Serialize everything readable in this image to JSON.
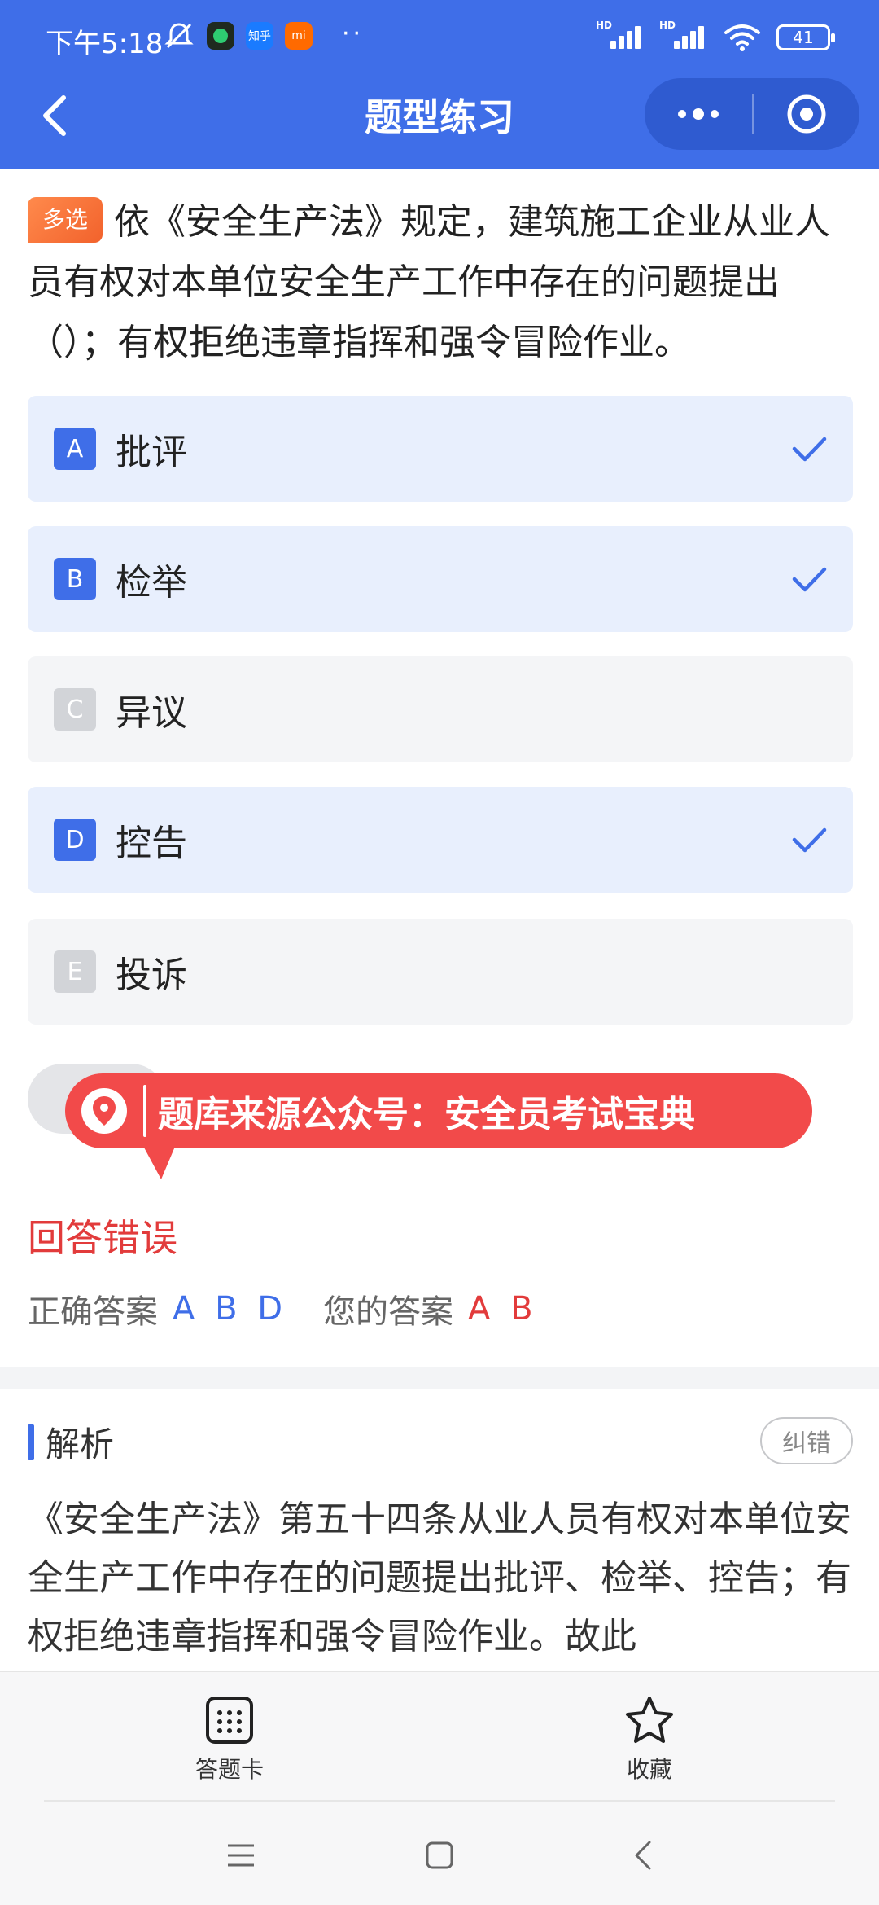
{
  "status_bar": {
    "time": "下午5:18",
    "app_icon_zhihu": "知乎",
    "app_icon_mi": "mi",
    "more_indicator": "··",
    "battery": "41",
    "signal_1": "HD",
    "signal_2": "HD"
  },
  "header": {
    "title": "题型练习"
  },
  "question": {
    "tag": "多选",
    "text": "依《安全生产法》规定，建筑施工企业从业人员有权对本单位安全生产工作中存在的问题提出（）；有权拒绝违章指挥和强令冒险作业。"
  },
  "options": [
    {
      "letter": "A",
      "text": "批评",
      "selected": true
    },
    {
      "letter": "B",
      "text": "检举",
      "selected": true
    },
    {
      "letter": "C",
      "text": "异议",
      "selected": false
    },
    {
      "letter": "D",
      "text": "控告",
      "selected": true
    },
    {
      "letter": "E",
      "text": "投诉",
      "selected": false
    }
  ],
  "watermark": {
    "text": "题库来源公众号：安全员考试宝典"
  },
  "result": {
    "title": "回答错误",
    "correct_label": "正确答案",
    "correct_value": "A B D",
    "yours_label": "您的答案",
    "yours_value": "A B"
  },
  "analysis": {
    "title": "解析",
    "report_label": "纠错",
    "text": "《安全生产法》第五十四条从业人员有权对本单位安全生产工作中存在的问题提出批评、检举、控告；有权拒绝违章指挥和强令冒险作业。故此"
  },
  "bottom_nav": {
    "answer_card_label": "答题卡",
    "favorite_label": "收藏"
  },
  "colors": {
    "primary": "#3f6ee8",
    "error": "#e23b3b",
    "tag": "#f2622c",
    "selected_bg": "#e8effd"
  }
}
